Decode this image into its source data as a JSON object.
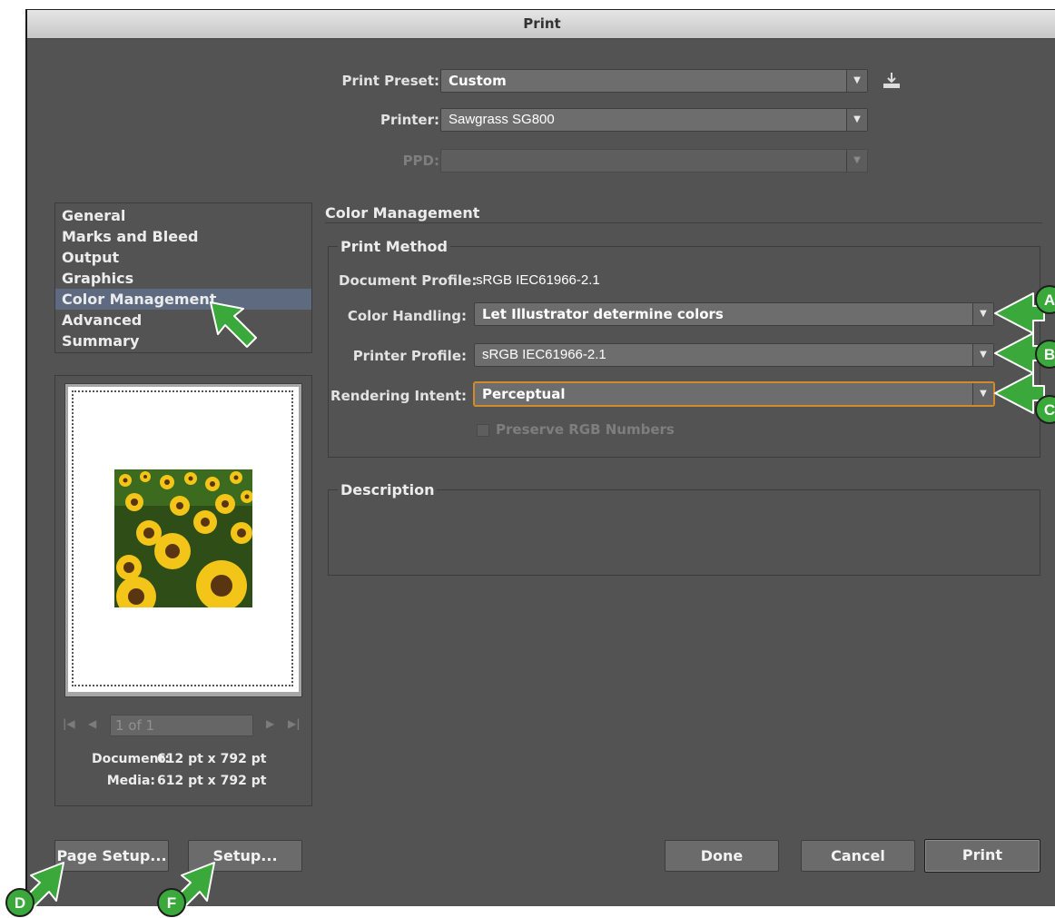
{
  "window": {
    "title": "Print"
  },
  "top": {
    "preset_label": "Print Preset:",
    "preset_value": "Custom",
    "printer_label": "Printer:",
    "printer_value": "Sawgrass SG800",
    "ppd_label": "PPD:",
    "ppd_value": ""
  },
  "categories": [
    "General",
    "Marks and Bleed",
    "Output",
    "Graphics",
    "Color Management",
    "Advanced",
    "Summary"
  ],
  "selected_category": "Color Management",
  "preview": {
    "page_field": "1 of 1",
    "document_label": "Document:",
    "document_value": "612 pt x 792 pt",
    "media_label": "Media:",
    "media_value": "612 pt x 792 pt"
  },
  "color_management": {
    "section_title": "Color Management",
    "print_method_legend": "Print Method",
    "document_profile_label": "Document Profile:",
    "document_profile_value": "sRGB IEC61966-2.1",
    "color_handling_label": "Color Handling:",
    "color_handling_value": "Let Illustrator determine colors",
    "printer_profile_label": "Printer Profile:",
    "printer_profile_value": "sRGB IEC61966-2.1",
    "rendering_intent_label": "Rendering Intent:",
    "rendering_intent_value": "Perceptual",
    "preserve_rgb_label": "Preserve RGB Numbers",
    "description_legend": "Description"
  },
  "buttons": {
    "page_setup": "Page Setup...",
    "setup": "Setup...",
    "done": "Done",
    "cancel": "Cancel",
    "print": "Print"
  },
  "callouts": [
    "A",
    "B",
    "C",
    "D",
    "F"
  ],
  "colors": {
    "callout_green": "#3aa83a",
    "dialog_bg": "#535353",
    "selection": "#5d6a80",
    "focus_ring": "#d18c2a"
  },
  "icons": {
    "save_preset": "save-preset-icon",
    "dropdown": "chevron-down-icon"
  }
}
